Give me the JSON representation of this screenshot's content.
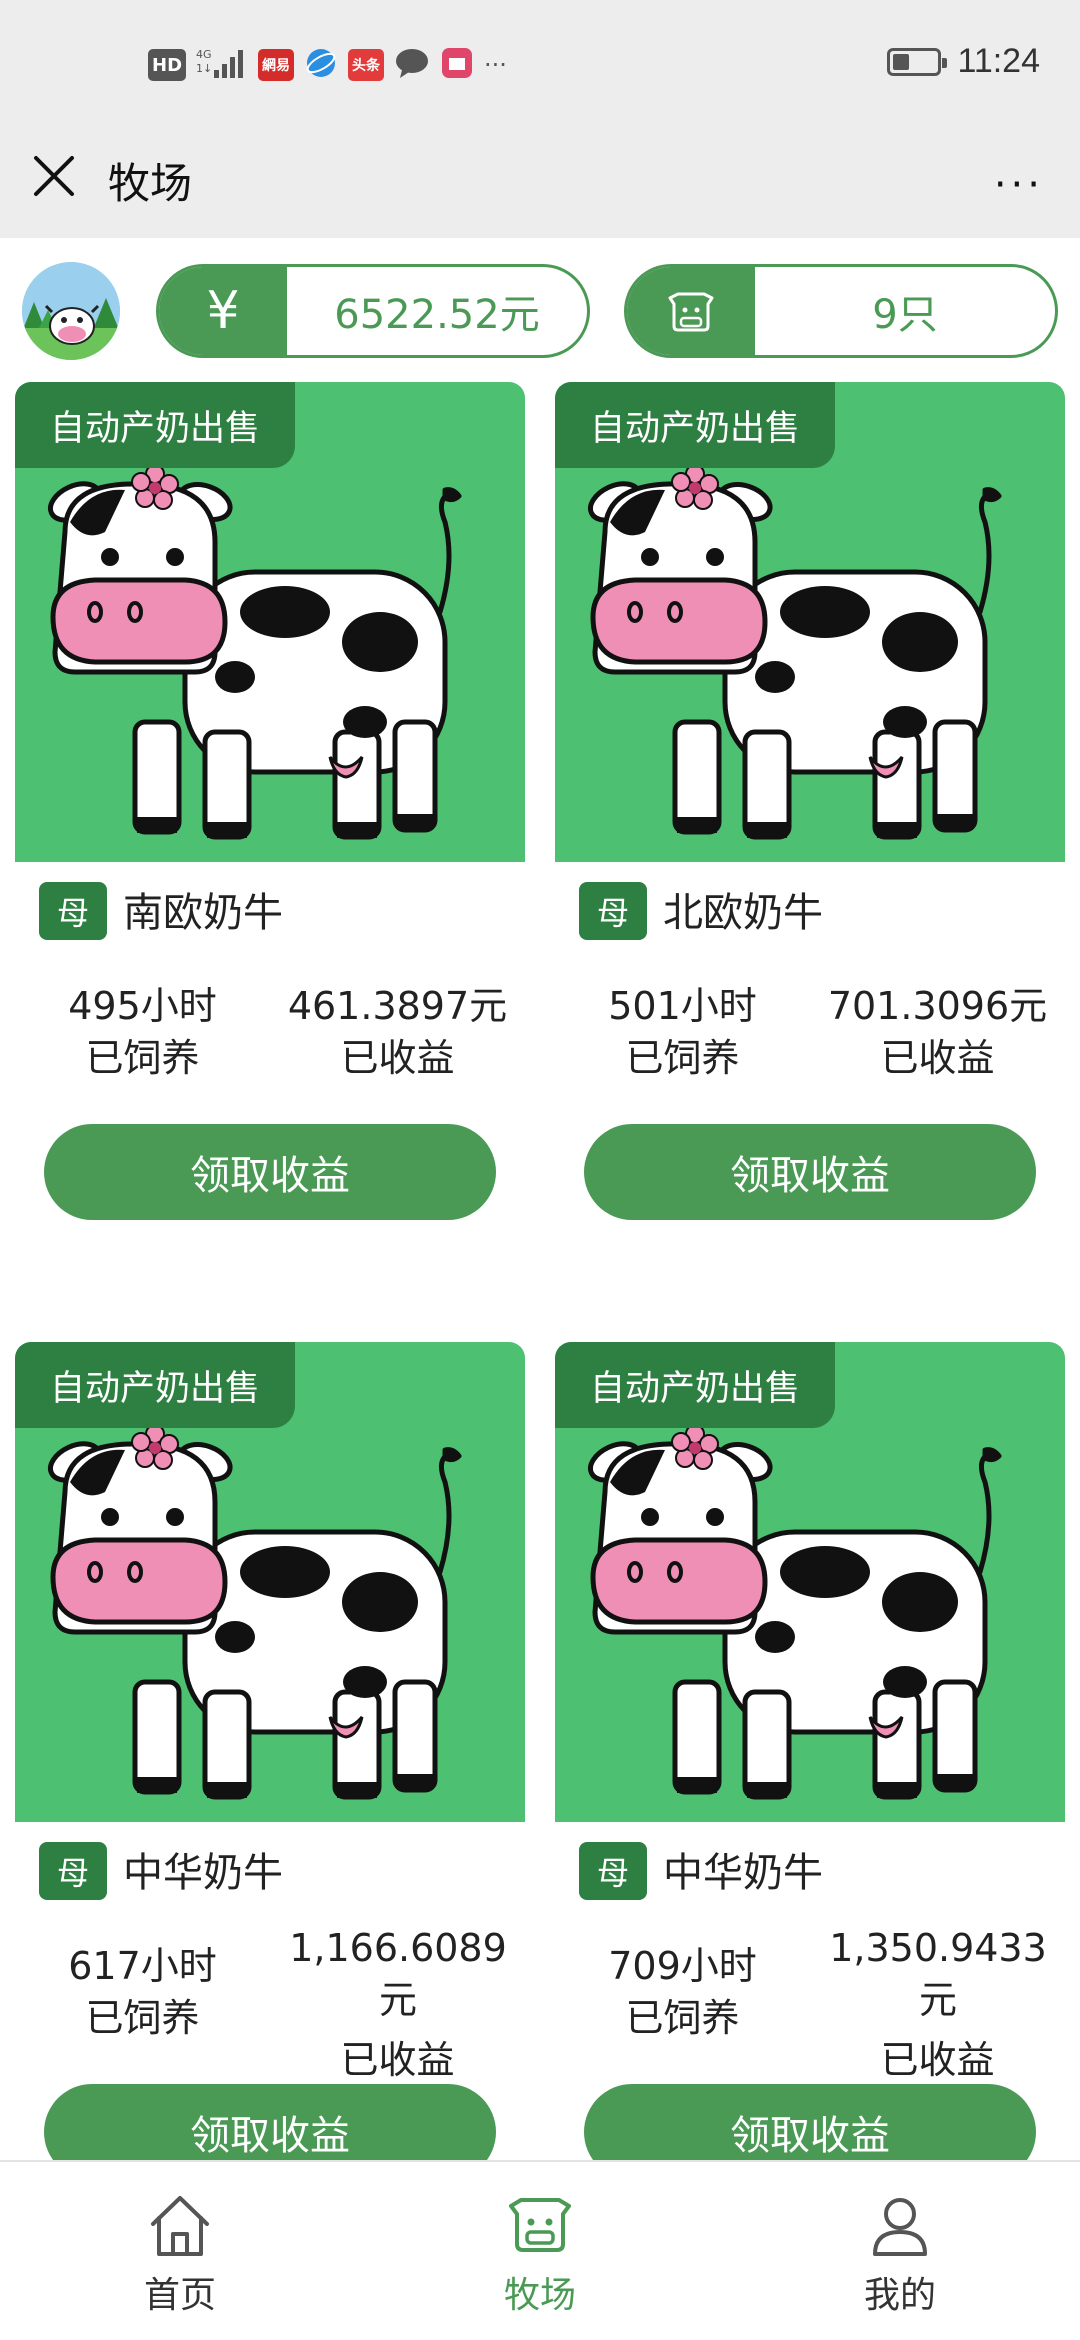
{
  "status_bar": {
    "left_icons": [
      "hd-icon",
      "4g-signal-icon",
      "netease-app-icon",
      "browser-app-icon",
      "toutiao-app-icon",
      "chat-app-icon",
      "shopping-app-icon",
      "more-dots-icon"
    ],
    "hd": "HD",
    "netease": "網易",
    "toutiao": "头条",
    "time": "11:24"
  },
  "navbar": {
    "title": "牧场",
    "more": "···"
  },
  "summary": {
    "balance_symbol": "¥",
    "balance": "6522.52元",
    "cow_count": "9只"
  },
  "cards": [
    {
      "tag": "自动产奶出售",
      "gender": "母",
      "breed": "南欧奶牛",
      "hours": "495小时",
      "hours_label": "已饲养",
      "income": "461.3897元",
      "income_label": "已收益",
      "button": "领取收益"
    },
    {
      "tag": "自动产奶出售",
      "gender": "母",
      "breed": "北欧奶牛",
      "hours": "501小时",
      "hours_label": "已饲养",
      "income": "701.3096元",
      "income_label": "已收益",
      "button": "领取收益"
    },
    {
      "tag": "自动产奶出售",
      "gender": "母",
      "breed": "中华奶牛",
      "hours": "617小时",
      "hours_label": "已饲养",
      "income": "1,166.6089元",
      "income_label": "已收益",
      "button": "领取收益"
    },
    {
      "tag": "自动产奶出售",
      "gender": "母",
      "breed": "中华奶牛",
      "hours": "709小时",
      "hours_label": "已饲养",
      "income": "1,350.9433元",
      "income_label": "已收益",
      "button": "领取收益"
    }
  ],
  "bottom_nav": {
    "tabs": [
      {
        "label": "首页",
        "icon": "home-icon",
        "active": false
      },
      {
        "label": "牧场",
        "icon": "cow-icon",
        "active": true
      },
      {
        "label": "我的",
        "icon": "user-icon",
        "active": false
      }
    ]
  },
  "colors": {
    "primary_green": "#4a9a55",
    "dark_green": "#2e8042",
    "image_bg_green": "#4dc171",
    "cow_pink": "#f08fb6"
  }
}
